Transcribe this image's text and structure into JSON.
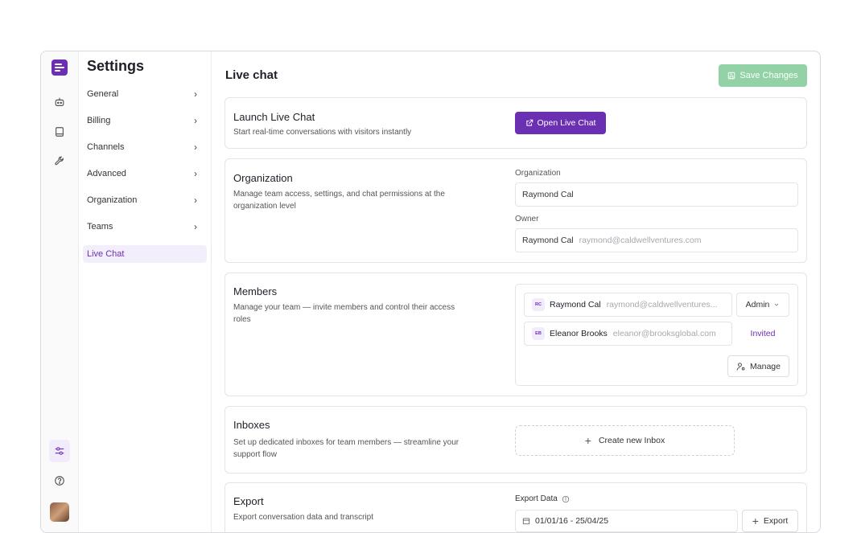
{
  "nav": {
    "title": "Settings",
    "items": [
      {
        "label": "General",
        "chevron": "›"
      },
      {
        "label": "Billing",
        "chevron": "›"
      },
      {
        "label": "Channels",
        "chevron": "›"
      },
      {
        "label": "Advanced",
        "chevron": "›"
      },
      {
        "label": "Organization",
        "chevron": "›"
      },
      {
        "label": "Teams",
        "chevron": "›"
      },
      {
        "label": "Live Chat"
      }
    ]
  },
  "rail": {
    "icons": [
      "bot-icon",
      "book-icon",
      "wrench-icon",
      "sliders-icon",
      "help-icon"
    ]
  },
  "page": {
    "title": "Live chat",
    "save_label": "Save Changes"
  },
  "launch": {
    "title": "Launch Live Chat",
    "desc": "Start real-time conversations with visitors instantly",
    "button": "Open Live Chat"
  },
  "organization": {
    "title": "Organization",
    "desc": "Manage team access, settings, and chat permissions at the organization level",
    "org_label": "Organization",
    "org_value": "Raymond Cal",
    "owner_label": "Owner",
    "owner_name": "Raymond Cal",
    "owner_email": "raymond@caldwellventures.com"
  },
  "members": {
    "title": "Members",
    "desc": "Manage your team — invite members and control their access roles",
    "list": [
      {
        "initials": "RC",
        "name": "Raymond Cal",
        "email": "raymond@caldwellventures...",
        "role": "Admin"
      },
      {
        "initials": "EB",
        "name": "Eleanor Brooks",
        "email": "eleanor@brooksglobal.com",
        "status": "Invited"
      }
    ],
    "manage": "Manage"
  },
  "inboxes": {
    "title": "Inboxes",
    "desc": "Set up dedicated inboxes for team members — streamline your support flow",
    "create": "Create new Inbox"
  },
  "export": {
    "title": "Export",
    "desc": "Export conversation data and transcript",
    "label": "Export Data",
    "range": "01/01/16 - 25/04/25",
    "button": "Export"
  }
}
